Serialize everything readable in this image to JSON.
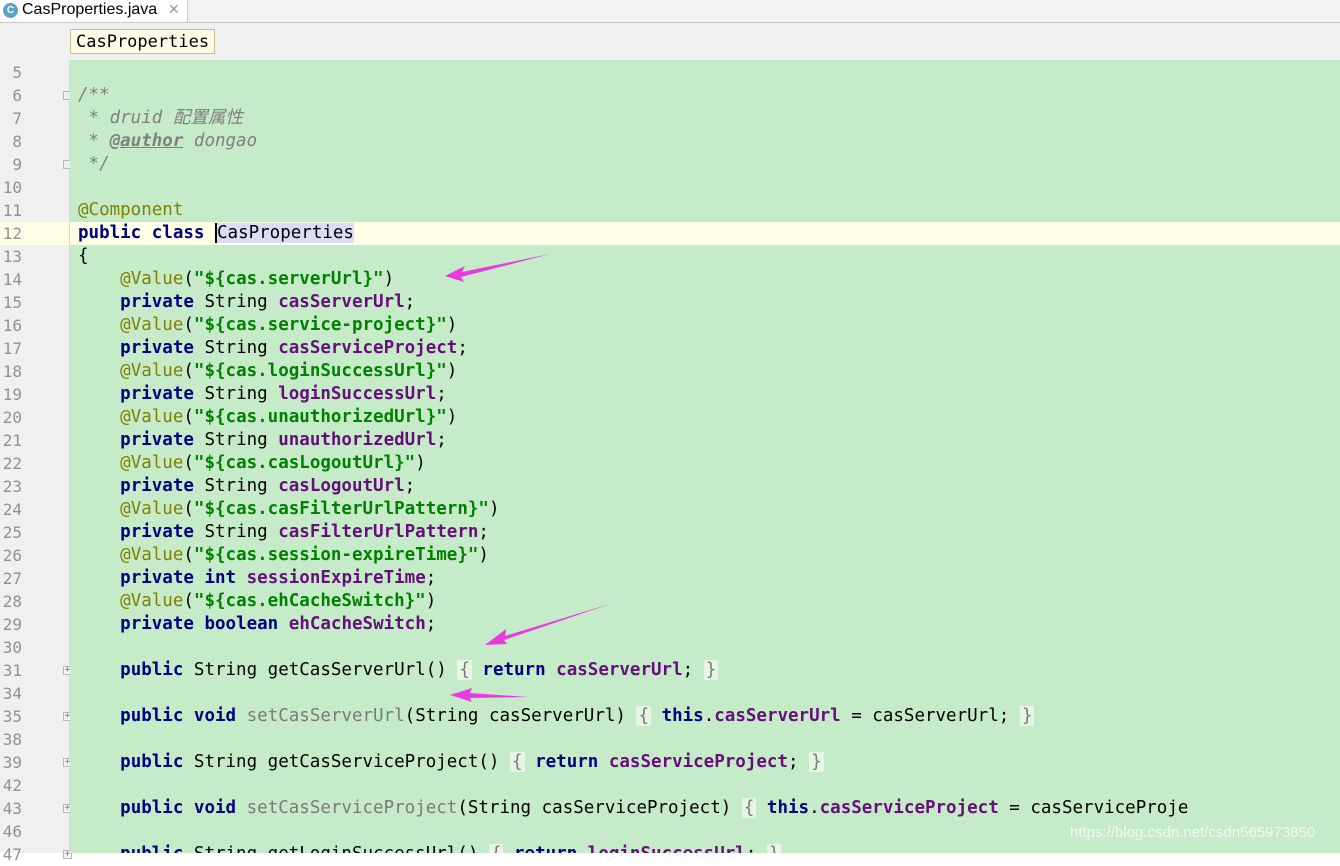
{
  "tab": {
    "icon": "C",
    "title": "CasProperties.java",
    "close": "✕"
  },
  "breadcrumb": "CasProperties",
  "watermark": "https://blog.csdn.net/csdn565973850",
  "lines": [
    {
      "n": "5",
      "t": ""
    },
    {
      "n": "6",
      "t": "/**"
    },
    {
      "n": "7",
      "t": " * druid 配置属性"
    },
    {
      "n": "8",
      "t": " * @author dongao"
    },
    {
      "n": "9",
      "t": " */"
    },
    {
      "n": "10",
      "t": ""
    },
    {
      "n": "11",
      "t": "@Component"
    },
    {
      "n": "12",
      "t": "public class CasProperties"
    },
    {
      "n": "13",
      "t": "{"
    },
    {
      "n": "14",
      "t": "    @Value(\"${cas.serverUrl}\")"
    },
    {
      "n": "15",
      "t": "    private String casServerUrl;"
    },
    {
      "n": "16",
      "t": "    @Value(\"${cas.service-project}\")"
    },
    {
      "n": "17",
      "t": "    private String casServiceProject;"
    },
    {
      "n": "18",
      "t": "    @Value(\"${cas.loginSuccessUrl}\")"
    },
    {
      "n": "19",
      "t": "    private String loginSuccessUrl;"
    },
    {
      "n": "20",
      "t": "    @Value(\"${cas.unauthorizedUrl}\")"
    },
    {
      "n": "21",
      "t": "    private String unauthorizedUrl;"
    },
    {
      "n": "22",
      "t": "    @Value(\"${cas.casLogoutUrl}\")"
    },
    {
      "n": "23",
      "t": "    private String casLogoutUrl;"
    },
    {
      "n": "24",
      "t": "    @Value(\"${cas.casFilterUrlPattern}\")"
    },
    {
      "n": "25",
      "t": "    private String casFilterUrlPattern;"
    },
    {
      "n": "26",
      "t": "    @Value(\"${cas.session-expireTime}\")"
    },
    {
      "n": "27",
      "t": "    private int sessionExpireTime;"
    },
    {
      "n": "28",
      "t": "    @Value(\"${cas.ehCacheSwitch}\")"
    },
    {
      "n": "29",
      "t": "    private boolean ehCacheSwitch;"
    },
    {
      "n": "30",
      "t": ""
    },
    {
      "n": "31",
      "t": "    public String getCasServerUrl() { return casServerUrl; }"
    },
    {
      "n": "34",
      "t": ""
    },
    {
      "n": "35",
      "t": "    public void setCasServerUrl(String casServerUrl) { this.casServerUrl = casServerUrl; }"
    },
    {
      "n": "38",
      "t": ""
    },
    {
      "n": "39",
      "t": "    public String getCasServiceProject() { return casServiceProject; }"
    },
    {
      "n": "42",
      "t": ""
    },
    {
      "n": "43",
      "t": "    public void setCasServiceProject(String casServiceProject) { this.casServiceProject = casServiceProje"
    },
    {
      "n": "46",
      "t": ""
    },
    {
      "n": "47",
      "t": "    public String getLoginSuccessUrl() { return loginSuccessUrl; }"
    }
  ],
  "colors": {
    "editor_bg": "#c6ebc9",
    "keyword": "#000080",
    "annotation": "#808000",
    "string": "#008000",
    "field": "#660e7a",
    "comment": "#808080",
    "arrow": "#e83ae0"
  }
}
